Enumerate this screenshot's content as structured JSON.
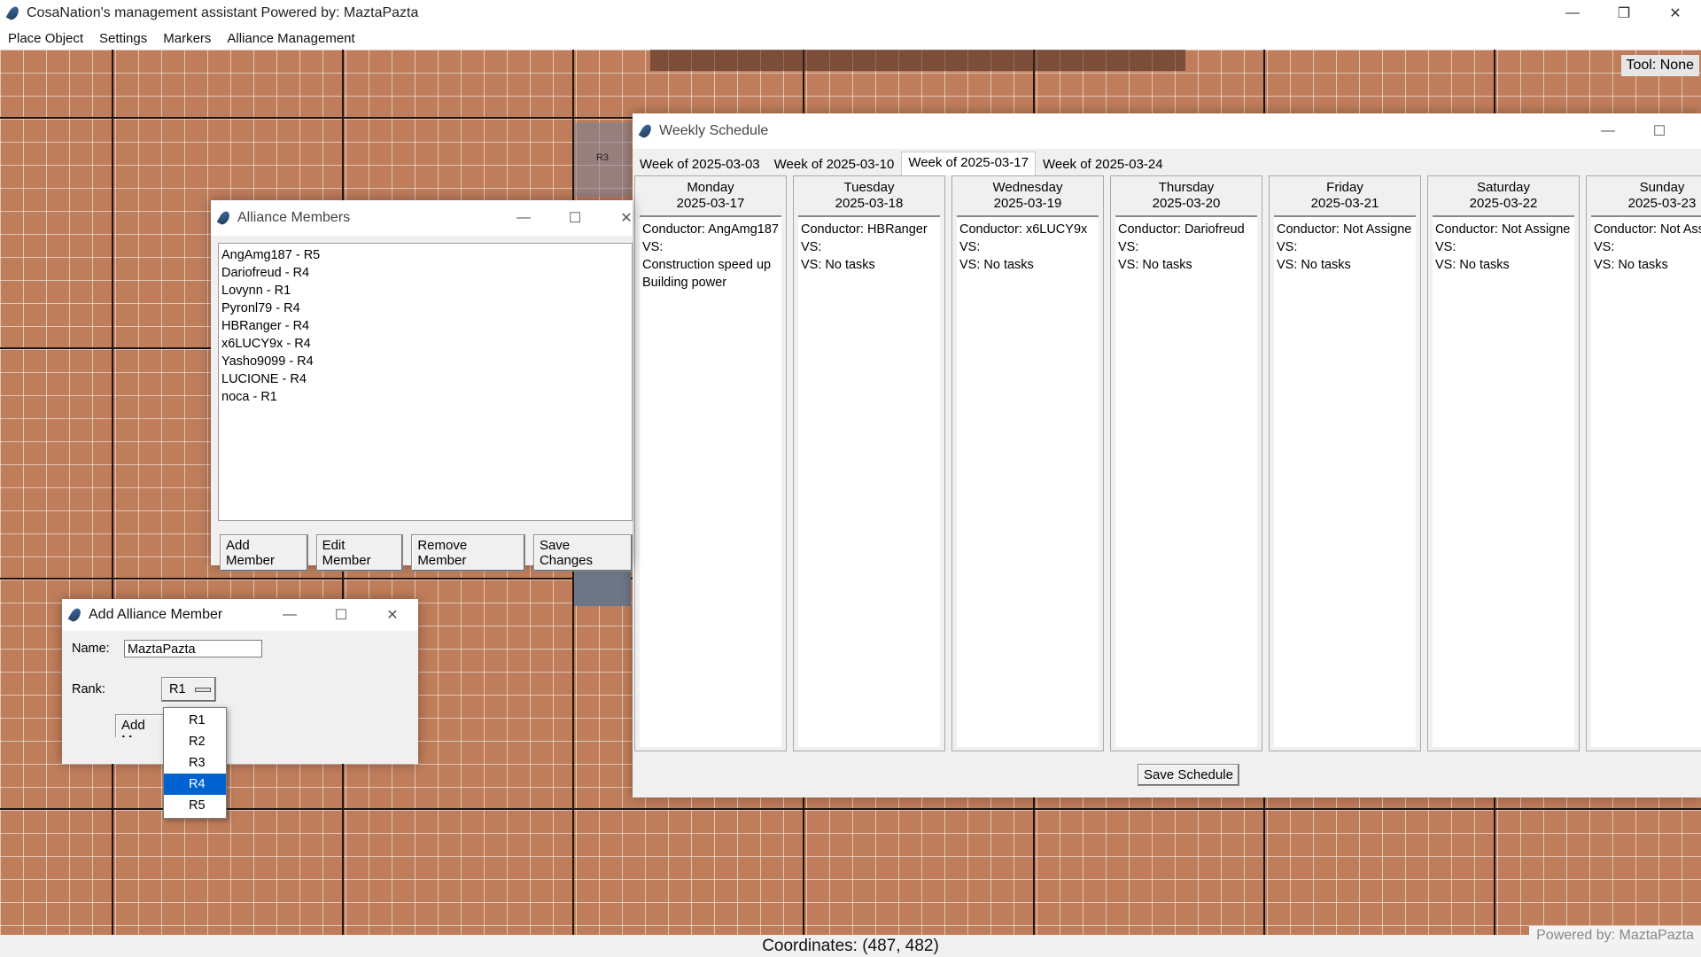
{
  "app": {
    "title": "CosaNation's management assistant   Powered by: MaztaPazta",
    "menu": [
      "Place Object",
      "Settings",
      "Markers",
      "Alliance Management"
    ],
    "tool_label": "Tool: None",
    "coordinates": "Coordinates: (487, 482)",
    "powered_by": "Powered by: MaztaPazta",
    "canvas_tile_label": "R3",
    "colors": {
      "canvas": "#bf7d5b",
      "selection": "#0063d1"
    }
  },
  "weekly": {
    "title": "Weekly Schedule",
    "tabs": [
      "Week of 2025-03-03",
      "Week of 2025-03-10",
      "Week of 2025-03-17",
      "Week of 2025-03-24"
    ],
    "active_tab": "Week of 2025-03-17",
    "days": [
      {
        "name": "Monday",
        "date": "2025-03-17",
        "lines": [
          "Conductor: AngAmg187",
          "VS:",
          "Construction speed up",
          "Building power"
        ]
      },
      {
        "name": "Tuesday",
        "date": "2025-03-18",
        "lines": [
          "Conductor: HBRanger",
          "VS:",
          "VS: No tasks"
        ]
      },
      {
        "name": "Wednesday",
        "date": "2025-03-19",
        "lines": [
          "Conductor: x6LUCY9x",
          "VS:",
          "VS: No tasks"
        ]
      },
      {
        "name": "Thursday",
        "date": "2025-03-20",
        "lines": [
          "Conductor: Dariofreud",
          "VS:",
          "VS: No tasks"
        ]
      },
      {
        "name": "Friday",
        "date": "2025-03-21",
        "lines": [
          "Conductor: Not Assigne",
          "VS:",
          "VS: No tasks"
        ]
      },
      {
        "name": "Saturday",
        "date": "2025-03-22",
        "lines": [
          "Conductor: Not Assigne",
          "VS:",
          "VS: No tasks"
        ]
      },
      {
        "name": "Sunday",
        "date": "2025-03-23",
        "lines": [
          "Conductor: Not Ass",
          "VS:",
          "VS: No tasks"
        ]
      }
    ],
    "save_label": "Save Schedule"
  },
  "alliance": {
    "title": "Alliance Members",
    "members": [
      "AngAmg187 - R5",
      "Dariofreud - R4",
      "Lovynn - R1",
      "Pyronl79 - R4",
      "HBRanger - R4",
      "x6LUCY9x - R4",
      "Yasho9099 - R4",
      "LUCIONE - R4",
      "noca - R1"
    ],
    "buttons": {
      "add": "Add Member",
      "edit": "Edit Member",
      "remove": "Remove Member",
      "save": "Save Changes"
    }
  },
  "add_member": {
    "title": "Add Alliance Member",
    "name_label": "Name:",
    "name_value": "MaztaPazta",
    "rank_label": "Rank:",
    "rank_value": "R1",
    "add_button_partial": "Add M",
    "rank_options": [
      "R1",
      "R2",
      "R3",
      "R4",
      "R5"
    ],
    "highlighted_option": "R4"
  }
}
